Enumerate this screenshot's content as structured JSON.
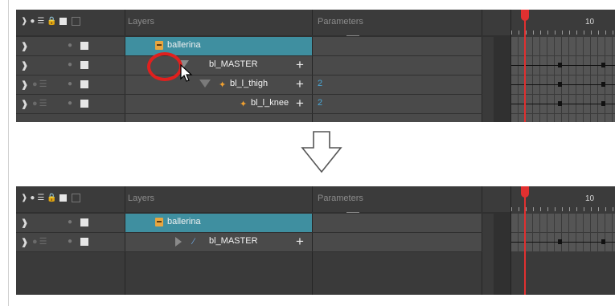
{
  "header": {
    "layers_label": "Layers",
    "parameters_label": "Parameters",
    "frame_number": "10"
  },
  "before": {
    "rows": [
      {
        "name": "ballerina",
        "param": ""
      },
      {
        "name": "bl_MASTER",
        "param": ""
      },
      {
        "name": "bl_l_thigh",
        "param": "2"
      },
      {
        "name": "bl_l_knee",
        "param": "2"
      }
    ]
  },
  "after": {
    "rows": [
      {
        "name": "ballerina",
        "param": ""
      },
      {
        "name": "bl_MASTER",
        "param": ""
      }
    ]
  },
  "colors": {
    "selected_row": "#3f8fa0",
    "highlight_circle": "#e0201e",
    "playhead": "#e03030",
    "param_value": "#4aa8d8"
  },
  "icons": [
    "eye-icon",
    "lock-icon",
    "color-swatch-icon",
    "add-layer-icon",
    "delete-layer-icon",
    "add-peg-icon",
    "group-icon",
    "bone-icon",
    "collapse-arrow-icon",
    "expand-arrow-icon",
    "down-arrow-icon",
    "mouse-cursor-icon"
  ]
}
